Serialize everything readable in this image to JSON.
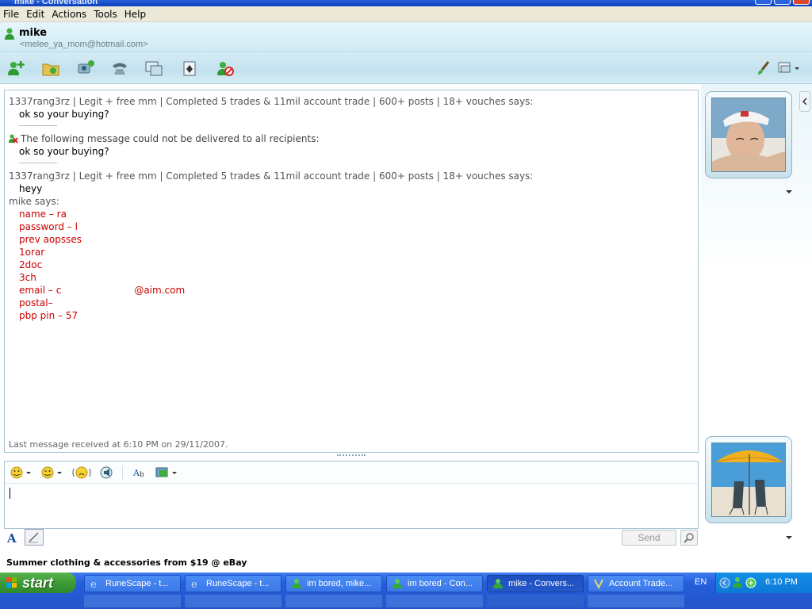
{
  "window": {
    "title": "mike - Conversation"
  },
  "menu": [
    "File",
    "Edit",
    "Actions",
    "Tools",
    "Help"
  ],
  "contact": {
    "name": "mike",
    "email": "<melee_ya_mom@hotmail.com>"
  },
  "toolbar": {
    "icons": [
      "invite-contact-icon",
      "send-files-icon",
      "video-call-icon",
      "phone-call-icon",
      "activities-icon",
      "games-icon",
      "block-contact-icon"
    ],
    "right_icons": [
      "paint-brush-icon",
      "layout-menu-icon"
    ]
  },
  "messages": {
    "m1_sender": "1337rang3rz | Legit + free mm | Completed 5 trades & 11mil account trade | 600+ posts | 18+ vouches says:",
    "m1_body": "ok so your buying?",
    "warn_text": "The following message could not be delivered to all recipients:",
    "warn_body": "ok so your buying?",
    "m2_sender": "1337rang3rz | Legit + free mm | Completed 5 trades & 11mil account trade | 600+ posts | 18+ vouches says:",
    "m2_body": "heyy",
    "m3_sender": "mike says:",
    "m3_lines": [
      "name – ra",
      "password – l",
      "prev aopsses",
      "1orar",
      "2doc",
      "3ch",
      "email – c",
      "postal–",
      "pbp pin – 57"
    ],
    "email_tail": "@aim.com"
  },
  "last_message": "Last message received at 6:10 PM on 29/11/2007.",
  "compose": {
    "icons": [
      "emoticon-icon",
      "wink-icon",
      "nudge-icon",
      "voice-clip-icon",
      "font-icon",
      "background-icon"
    ],
    "send_label": "Send"
  },
  "ad": {
    "text": "Summer clothing & accessories from $19 @ eBay"
  },
  "taskbar": {
    "start_label": "start",
    "tasks": [
      "RuneScape - t...",
      "RuneScape - t...",
      "im bored, mike...",
      "im bored - Con...",
      "mike - Convers...",
      "Account Trade..."
    ],
    "active_index": 4,
    "language": "EN",
    "clock": "6:10 PM"
  },
  "colors": {
    "accent": "#245edb",
    "message_red": "#cc0000",
    "window_bg": "#ece9d8"
  }
}
